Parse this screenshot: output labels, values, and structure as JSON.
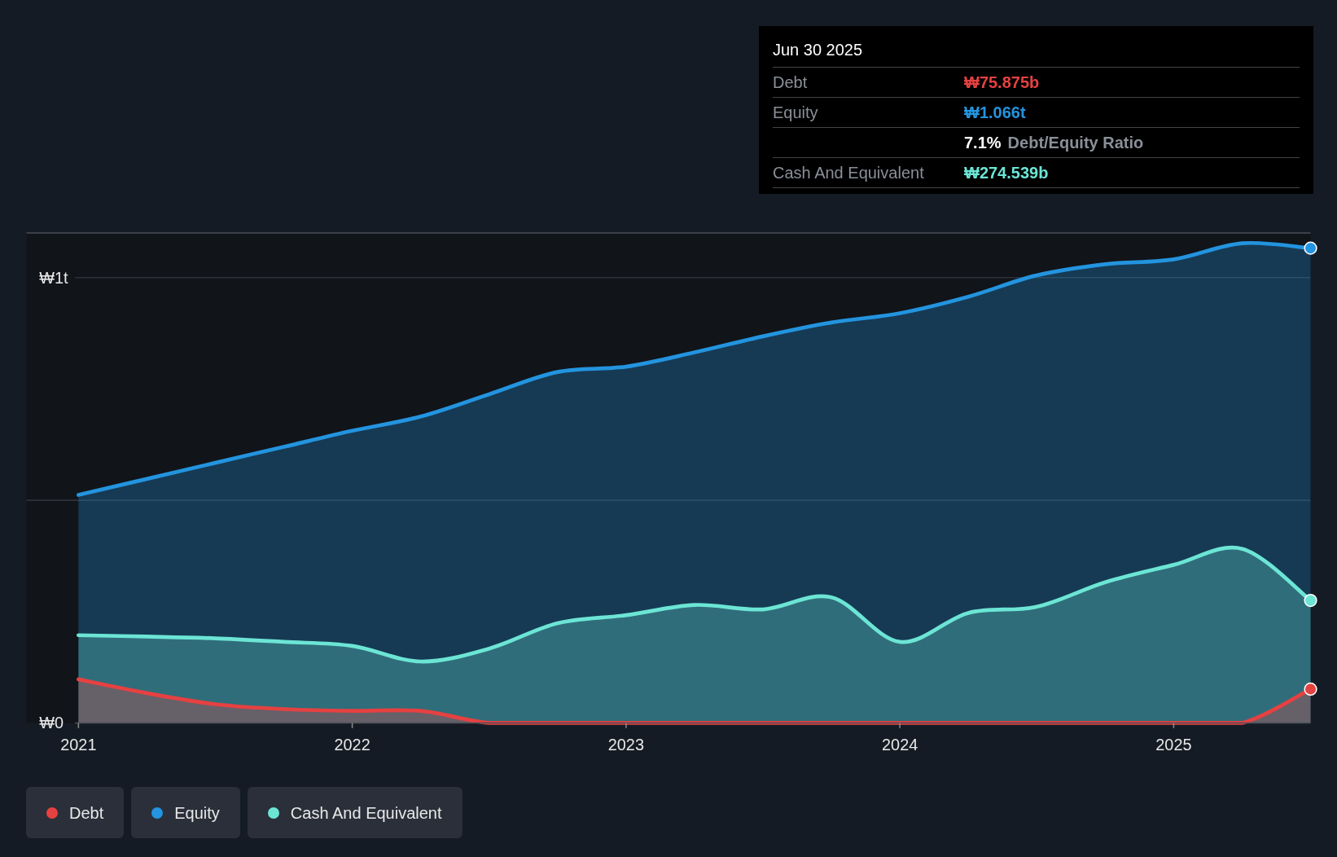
{
  "tooltip": {
    "date": "Jun 30 2025",
    "rows": [
      {
        "kind": "value",
        "label": "Debt",
        "value": "₩75.875b",
        "color": "#e64141"
      },
      {
        "kind": "value",
        "label": "Equity",
        "value": "₩1.066t",
        "color": "#2394df"
      },
      {
        "kind": "ratio",
        "value": "7.1%",
        "label": "Debt/Equity Ratio"
      },
      {
        "kind": "value",
        "label": "Cash And Equivalent",
        "value": "₩274.539b",
        "color": "#6ce5d5"
      }
    ]
  },
  "chart_data": {
    "type": "area",
    "x": [
      2021,
      2021.25,
      2021.5,
      2021.75,
      2022,
      2022.25,
      2022.5,
      2022.75,
      2023,
      2023.25,
      2023.5,
      2023.75,
      2024,
      2024.25,
      2024.5,
      2024.75,
      2025,
      2025.25,
      2025.5
    ],
    "series": [
      {
        "name": "Debt",
        "color": "#e64141",
        "values": [
          0.098,
          0.067,
          0.042,
          0.031,
          0.027,
          0.027,
          0,
          0,
          0,
          0,
          0,
          0,
          0,
          0,
          0,
          0,
          0,
          0,
          0.076
        ]
      },
      {
        "name": "Equity",
        "color": "#2394df",
        "values": [
          0.512,
          0.548,
          0.584,
          0.62,
          0.656,
          0.688,
          0.738,
          0.788,
          0.8,
          0.832,
          0.868,
          0.899,
          0.92,
          0.957,
          1.005,
          1.03,
          1.041,
          1.077,
          1.066
        ]
      },
      {
        "name": "Cash And Equivalent",
        "color": "#6ce5d5",
        "values": [
          0.197,
          0.194,
          0.19,
          0.182,
          0.173,
          0.138,
          0.167,
          0.224,
          0.242,
          0.265,
          0.255,
          0.282,
          0.182,
          0.247,
          0.261,
          0.316,
          0.355,
          0.391,
          0.275
        ]
      }
    ],
    "xlim": [
      2020.81,
      2025.5
    ],
    "ylim": [
      0,
      1.1
    ],
    "xticks": [
      2021,
      2022,
      2023,
      2024,
      2025
    ],
    "yticks": [
      {
        "value": 0,
        "label": "₩0"
      },
      {
        "value": 1,
        "label": "₩1t"
      }
    ]
  }
}
